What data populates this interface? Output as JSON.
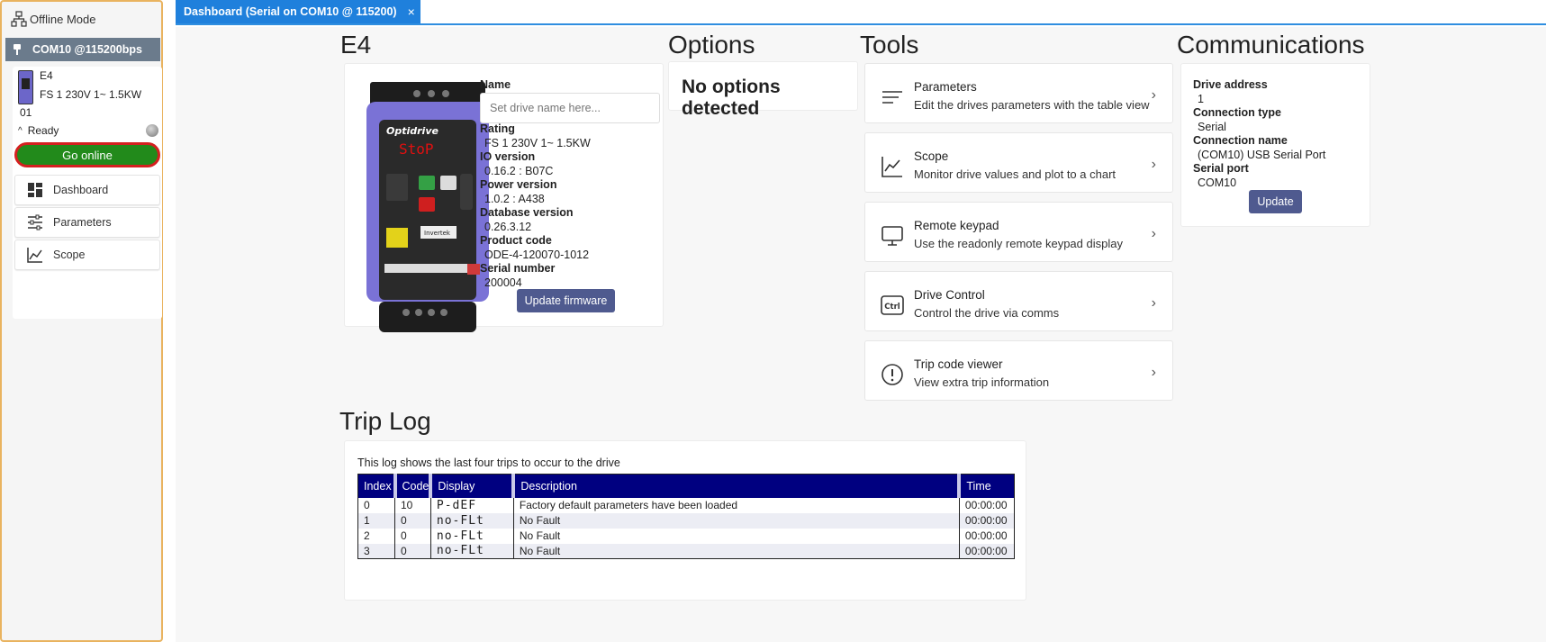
{
  "sidebar": {
    "offline_mode": "Offline Mode",
    "connection": "COM10 @115200bps",
    "drive": {
      "name": "E4",
      "rating": "FS 1 230V 1~ 1.5KW",
      "address": "01",
      "status": "Ready"
    },
    "go_online": "Go online",
    "nav": [
      {
        "label": "Dashboard",
        "icon": "dashboard-icon"
      },
      {
        "label": "Parameters",
        "icon": "sliders-icon"
      },
      {
        "label": "Scope",
        "icon": "line-chart-icon"
      }
    ]
  },
  "tab": {
    "label": "Dashboard (Serial on COM10 @ 115200)",
    "close": "×"
  },
  "drive_section": {
    "title": "E4",
    "name_label": "Name",
    "name_placeholder": "Set drive name here...",
    "rating_label": "Rating",
    "rating": "FS 1 230V 1~ 1.5KW",
    "io_label": "IO version",
    "io": "0.16.2 : B07C",
    "power_label": "Power version",
    "power": "1.0.2 : A438",
    "db_label": "Database version",
    "db": "0.26.3.12",
    "product_label": "Product code",
    "product": "ODE-4-120070-1012",
    "serial_label": "Serial number",
    "serial": "200004",
    "update_firmware": "Update firmware",
    "image": {
      "brand": "Optidrive",
      "display": "StoP",
      "maker": "Invertek"
    }
  },
  "options": {
    "title": "Options",
    "text": "No options detected"
  },
  "tools": {
    "title": "Tools",
    "items": [
      {
        "title": "Parameters",
        "desc": "Edit the drives parameters with the table view",
        "icon": "list-icon"
      },
      {
        "title": "Scope",
        "desc": "Monitor drive values and plot to a chart",
        "icon": "chart-icon"
      },
      {
        "title": "Remote keypad",
        "desc": "Use the readonly remote keypad display",
        "icon": "monitor-icon"
      },
      {
        "title": "Drive Control",
        "desc": "Control the drive via comms",
        "icon": "ctrl-key-icon"
      },
      {
        "title": "Trip code viewer",
        "desc": "View extra trip information",
        "icon": "alert-icon"
      }
    ]
  },
  "comms": {
    "title": "Communications",
    "addr_label": "Drive address",
    "addr": "1",
    "type_label": "Connection type",
    "type": "Serial",
    "name_label": "Connection name",
    "name": "(COM10) USB Serial Port",
    "port_label": "Serial port",
    "port": "COM10",
    "update": "Update"
  },
  "trip_log": {
    "title": "Trip Log",
    "intro": "This log shows the last four trips to occur to the drive",
    "headers": [
      "Index",
      "Code",
      "Display",
      "Description",
      "Time"
    ],
    "rows": [
      [
        "0",
        "10",
        "P-dEF",
        "Factory default parameters have been loaded",
        "00:00:00"
      ],
      [
        "1",
        "0",
        "no-FLt",
        "No Fault",
        "00:00:00"
      ],
      [
        "2",
        "0",
        "no-FLt",
        "No Fault",
        "00:00:00"
      ],
      [
        "3",
        "0",
        "no-FLt",
        "No Fault",
        "00:00:00"
      ]
    ]
  },
  "colors": {
    "accent": "#1f80dc",
    "go_online": "#228a1b",
    "table_header": "#000080",
    "button": "#4f5a8f"
  }
}
